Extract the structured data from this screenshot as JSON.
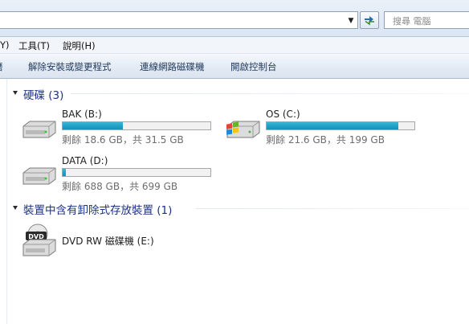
{
  "address_bar": {
    "refresh_icon": "refresh-arrows-icon",
    "search_placeholder": "搜尋 電腦"
  },
  "menu": {
    "items": [
      {
        "label": "Y)"
      },
      {
        "label": "工具(T)"
      },
      {
        "label": "說明(H)"
      }
    ]
  },
  "command_bar": {
    "items": [
      {
        "label": "磨"
      },
      {
        "label": "解除安裝或變更程式"
      },
      {
        "label": "連線網路磁碟機"
      },
      {
        "label": "開啟控制台"
      }
    ]
  },
  "groups": {
    "hard_disks": {
      "title": "硬碟 (3)",
      "drives": [
        {
          "name": "BAK (B:)",
          "info": "剩餘 18.6 GB，共 31.5 GB",
          "used_fraction": 0.41,
          "icon": "hard-drive-icon"
        },
        {
          "name": "OS (C:)",
          "info": "剩餘 21.6 GB，共 199 GB",
          "used_fraction": 0.89,
          "icon": "windows-drive-icon"
        },
        {
          "name": "DATA (D:)",
          "info": "剩餘 688 GB，共 699 GB",
          "used_fraction": 0.02,
          "icon": "hard-drive-icon"
        }
      ]
    },
    "removable": {
      "title": "裝置中含有卸除式存放裝置 (1)",
      "drives": [
        {
          "name": "DVD RW 磁碟機 (E:)",
          "icon": "dvd-drive-icon",
          "icon_label": "DVD"
        }
      ]
    }
  },
  "colors": {
    "group_title": "#1e3287",
    "bar_fill": "#20a3c7"
  }
}
